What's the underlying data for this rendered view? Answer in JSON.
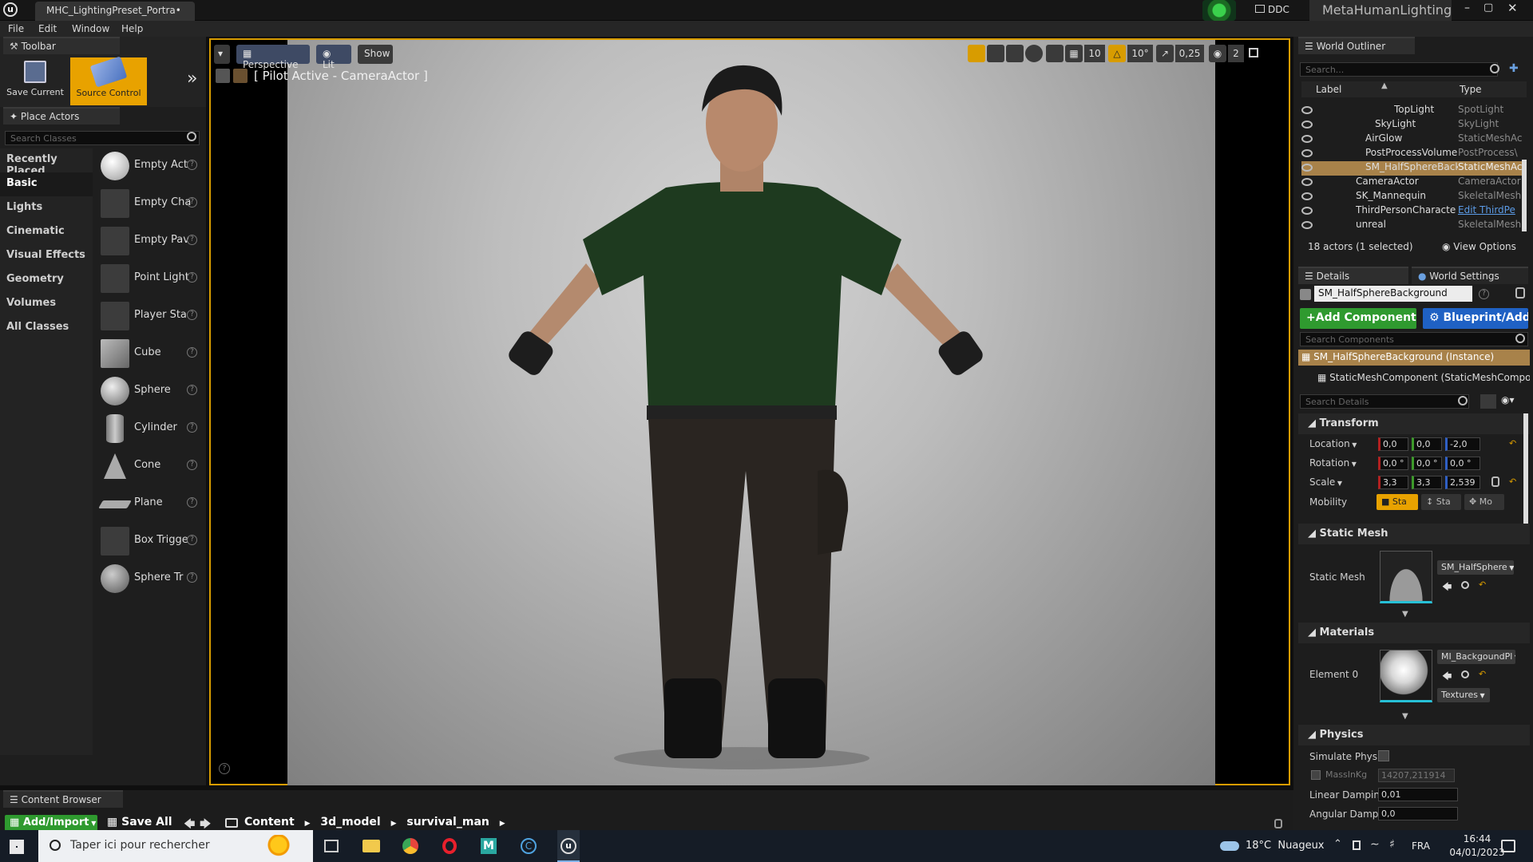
{
  "titlebar": {
    "doc_tab": "MHC_LightingPreset_Portra•",
    "ddc": "DDC",
    "project": "MetaHumanLighting"
  },
  "menu": [
    "File",
    "Edit",
    "Window",
    "Help"
  ],
  "toolbar": {
    "tab": "Toolbar",
    "save_label": "Save Current",
    "source_control_label": "Source Control"
  },
  "place_actors": {
    "tab": "Place Actors",
    "search_placeholder": "Search Classes",
    "categories": [
      "Recently Placed",
      "Basic",
      "Lights",
      "Cinematic",
      "Visual Effects",
      "Geometry",
      "Volumes",
      "All Classes"
    ],
    "selected_category": "Basic",
    "items": [
      "Empty Act",
      "Empty Cha",
      "Empty Pav",
      "Point Light",
      "Player Sta",
      "Cube",
      "Sphere",
      "Cylinder",
      "Cone",
      "Plane",
      "Box Trigge",
      "Sphere Tr"
    ]
  },
  "viewport": {
    "perspective": "Perspective",
    "lit": "Lit",
    "show": "Show",
    "pilot": "[ Pilot Active - CameraActor ]",
    "grid_snap": "10",
    "rot_snap": "10°",
    "scale_snap": "0,25",
    "camera_speed": "2"
  },
  "outliner": {
    "tab": "World Outliner",
    "search_placeholder": "Search...",
    "col_label": "Label",
    "col_type": "Type",
    "rows": [
      {
        "label": "TopLight",
        "type": "SpotLight"
      },
      {
        "label": "SkyLight",
        "type": "SkyLight"
      },
      {
        "label": "AirGlow",
        "type": "StaticMeshAc"
      },
      {
        "label": "PostProcessVolume",
        "type": "PostProcess\\"
      },
      {
        "label": "SM_HalfSphereBackg",
        "type": "StaticMeshAc"
      },
      {
        "label": "CameraActor",
        "type": "CameraActor"
      },
      {
        "label": "SK_Mannequin",
        "type": "SkeletalMesh"
      },
      {
        "label": "ThirdPersonCharacter",
        "type": "Edit ThirdPe"
      },
      {
        "label": "unreal",
        "type": "SkeletalMesh"
      }
    ],
    "selected_index": 4,
    "status": "18 actors (1 selected)",
    "view_options": "View Options"
  },
  "details": {
    "tab": "Details",
    "world_settings_tab": "World Settings",
    "actor_name": "SM_HalfSphereBackground",
    "add_component": "Add Component",
    "blueprint": "Blueprint/Add",
    "search_components": "Search Components",
    "components": [
      "SM_HalfSphereBackground (Instance)",
      "StaticMeshComponent (StaticMeshComponent"
    ],
    "search_details": "Search Details",
    "transform": {
      "header": "Transform",
      "location_label": "Location",
      "rotation_label": "Rotation",
      "scale_label": "Scale",
      "mobility_label": "Mobility",
      "location": [
        "0,0",
        "0,0",
        "-2,0"
      ],
      "rotation": [
        "0,0 °",
        "0,0 °",
        "0,0 °"
      ],
      "scale": [
        "3,3",
        "3,3",
        "2,539"
      ],
      "mobility": [
        "Sta",
        "Sta",
        "Mo"
      ]
    },
    "static_mesh": {
      "header": "Static Mesh",
      "label": "Static Mesh",
      "value": "SM_HalfSphere"
    },
    "materials": {
      "header": "Materials",
      "label": "Element 0",
      "value": "MI_BackgoundPl",
      "textures": "Textures"
    },
    "physics": {
      "header": "Physics",
      "simulate": "Simulate Physic",
      "mass": "MassInKg",
      "mass_value": "14207,211914",
      "linear_damping_label": "Linear Damping",
      "linear_damping": "0,01",
      "angular_damping_label": "Angular Dampin",
      "angular_damping": "0,0"
    }
  },
  "content_browser": {
    "tab": "Content Browser",
    "add_import": "Add/Import",
    "save_all": "Save All",
    "path": [
      "Content",
      "3d_model",
      "survival_man"
    ]
  },
  "taskbar": {
    "search_placeholder": "Taper ici pour rechercher",
    "weather": "18°C  Nuageux",
    "lang": "FRA",
    "time": "16:44",
    "date": "04/01/2023"
  },
  "colors": {
    "accent_orange": "#e8a200",
    "add_green": "#2f9a2f",
    "blueprint_blue": "#1f61c4",
    "selection": "#a8824a"
  }
}
